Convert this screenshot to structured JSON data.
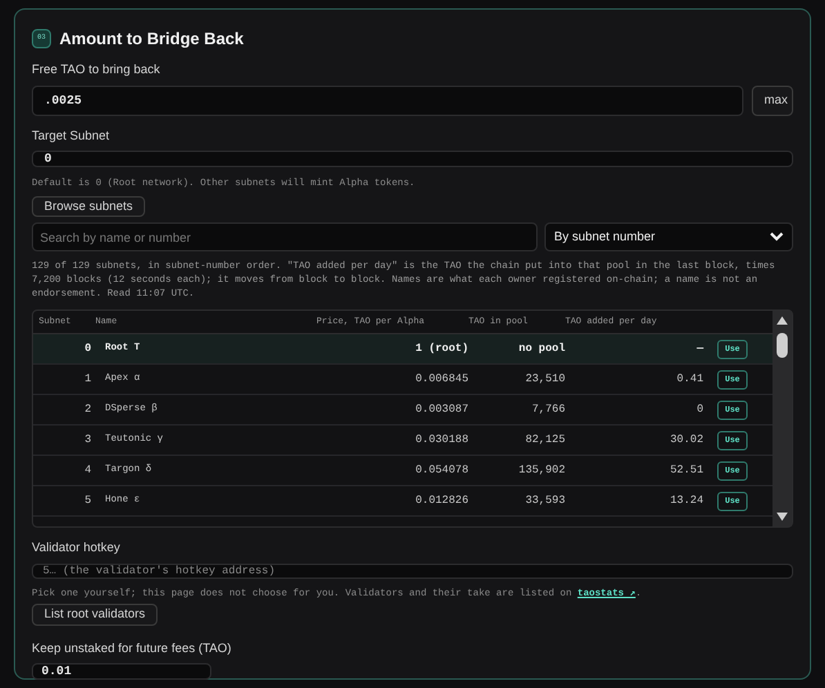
{
  "section": {
    "badge": "03",
    "title": "Amount to Bridge Back"
  },
  "amount": {
    "label": "Free TAO to bring back",
    "value": ".0025",
    "max_button": "max"
  },
  "target": {
    "label": "Target Subnet",
    "value": "0",
    "hint": "Default is 0 (Root network). Other subnets will mint Alpha tokens.",
    "browse_button": "Browse subnets"
  },
  "search": {
    "placeholder": "Search by name or number"
  },
  "sort": {
    "value": "By subnet number"
  },
  "note": "129 of 129 subnets, in subnet-number order. \"TAO added per day\" is the TAO the chain put into that pool in the last block, times 7,200 blocks (12 seconds each); it moves from block to block. Names are what each owner registered on-chain; a name is not an endorsement. Read 11:07 UTC.",
  "table": {
    "columns": [
      "Subnet",
      "Name",
      "Price, TAO per Alpha",
      "TAO in pool",
      "TAO added per day"
    ],
    "rows": [
      {
        "subnet": "0",
        "name": "Root Τ",
        "price": "1 (root)",
        "pool": "no pool",
        "per_day": "—",
        "action": "Use",
        "selected": true
      },
      {
        "subnet": "1",
        "name": "Apex α",
        "price": "0.006845",
        "pool": "23,510",
        "per_day": "0.41",
        "action": "Use",
        "selected": false
      },
      {
        "subnet": "2",
        "name": "DSperse β",
        "price": "0.003087",
        "pool": "7,766",
        "per_day": "0",
        "action": "Use",
        "selected": false
      },
      {
        "subnet": "3",
        "name": "Teutonic γ",
        "price": "0.030188",
        "pool": "82,125",
        "per_day": "30.02",
        "action": "Use",
        "selected": false
      },
      {
        "subnet": "4",
        "name": "Targon δ",
        "price": "0.054078",
        "pool": "135,902",
        "per_day": "52.51",
        "action": "Use",
        "selected": false
      },
      {
        "subnet": "5",
        "name": "Hone ε",
        "price": "0.012826",
        "pool": "33,593",
        "per_day": "13.24",
        "action": "Use",
        "selected": false
      }
    ]
  },
  "validator": {
    "label": "Validator hotkey",
    "placeholder": "5… (the validator's hotkey address)",
    "hint": "Pick one yourself; this page does not choose for you. Validators and their take are listed on ",
    "link": "taostats ↗",
    "hint_end": ".",
    "list_button": "List root validators"
  },
  "reserve": {
    "label": "Keep unstaked for future fees (TAO)",
    "value": "0.01"
  }
}
